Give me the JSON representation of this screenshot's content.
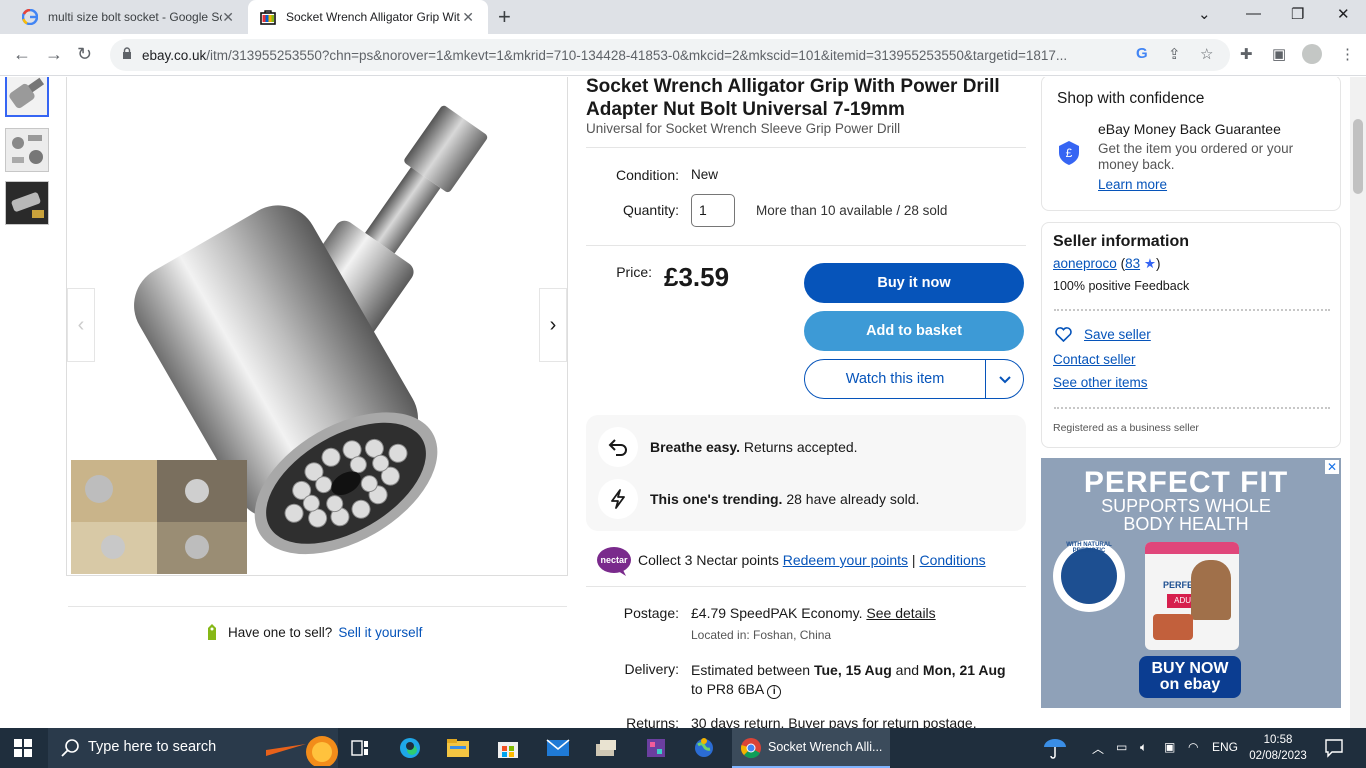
{
  "browser": {
    "tabs": [
      {
        "title": "multi size bolt socket - Google Sc",
        "active": false
      },
      {
        "title": "Socket Wrench Alligator Grip Wit",
        "active": true
      }
    ],
    "url_host": "ebay.co.uk",
    "url_path": "/itm/313955253550?chn=ps&norover=1&mkevt=1&mkrid=710-134428-41853-0&mkcid=2&mkscid=101&itemid=313955253550&targetid=1817..."
  },
  "product": {
    "title": "Socket Wrench Alligator Grip With Power Drill Adapter Nut Bolt Universal 7-19mm",
    "subtitle": "Universal for Socket Wrench Sleeve Grip Power Drill",
    "condition_label": "Condition:",
    "condition_value": "New",
    "quantity_label": "Quantity:",
    "quantity_value": "1",
    "availability": "More than 10 available / 28 sold",
    "price_label": "Price:",
    "price": "£3.59",
    "buy_now": "Buy it now",
    "add_to_basket": "Add to basket",
    "watch": "Watch this item",
    "returns_bold": "Breathe easy.",
    "returns_text": " Returns accepted.",
    "trending_bold": "This one's trending.",
    "trending_text": " 28 have already sold.",
    "nectar_text": "Collect 3 Nectar points ",
    "nectar_redeem": "Redeem your points",
    "nectar_sep": " | ",
    "nectar_conditions": "Conditions",
    "postage_label": "Postage:",
    "postage_price": "£4.79",
    "postage_service": " SpeedPAK Economy. ",
    "postage_details": "See details",
    "located": "Located in: Foshan, China",
    "delivery_label": "Delivery:",
    "delivery_prefix": "Estimated between ",
    "delivery_from": "Tue, 15 Aug",
    "delivery_and": " and ",
    "delivery_to": "Mon, 21 Aug",
    "delivery_suffix": " to PR8 6BA",
    "returns_label": "Returns:",
    "returns_value": "30 days return. Buyer pays for return postage."
  },
  "sell": {
    "prompt": "Have one to sell?",
    "link": "Sell it yourself"
  },
  "confidence": {
    "heading": "Shop with confidence",
    "guarantee_title": "eBay Money Back Guarantee",
    "guarantee_text": "Get the item you ordered or your money back.",
    "learn_more": "Learn more"
  },
  "seller": {
    "heading": "Seller information",
    "name": "aoneproco",
    "score_open": " (",
    "score": "83",
    "score_close": ")",
    "feedback": "100% positive Feedback",
    "save": "Save seller",
    "contact": "Contact seller",
    "other": "See other items",
    "business": "Registered as a business seller"
  },
  "ad": {
    "headline": "PERFECT FIT",
    "sub1": "SUPPORTS WHOLE",
    "sub2": "BODY HEALTH",
    "badge": "WITH NATURAL PREBIOTIC",
    "pack_brand": "PERFECT FIT",
    "pack_variant": "ADULT",
    "cta1": "BUY NOW",
    "cta2": "on ebay",
    "close": "✕"
  },
  "taskbar": {
    "search_placeholder": "Type here to search",
    "chrome_label": "Socket Wrench Alli...",
    "lang": "ENG",
    "time": "10:58",
    "date": "02/08/2023"
  },
  "colors": {
    "ebay_blue": "#0654ba",
    "basket_blue": "#3d9ad6",
    "taskbar": "#1f2e3d"
  }
}
